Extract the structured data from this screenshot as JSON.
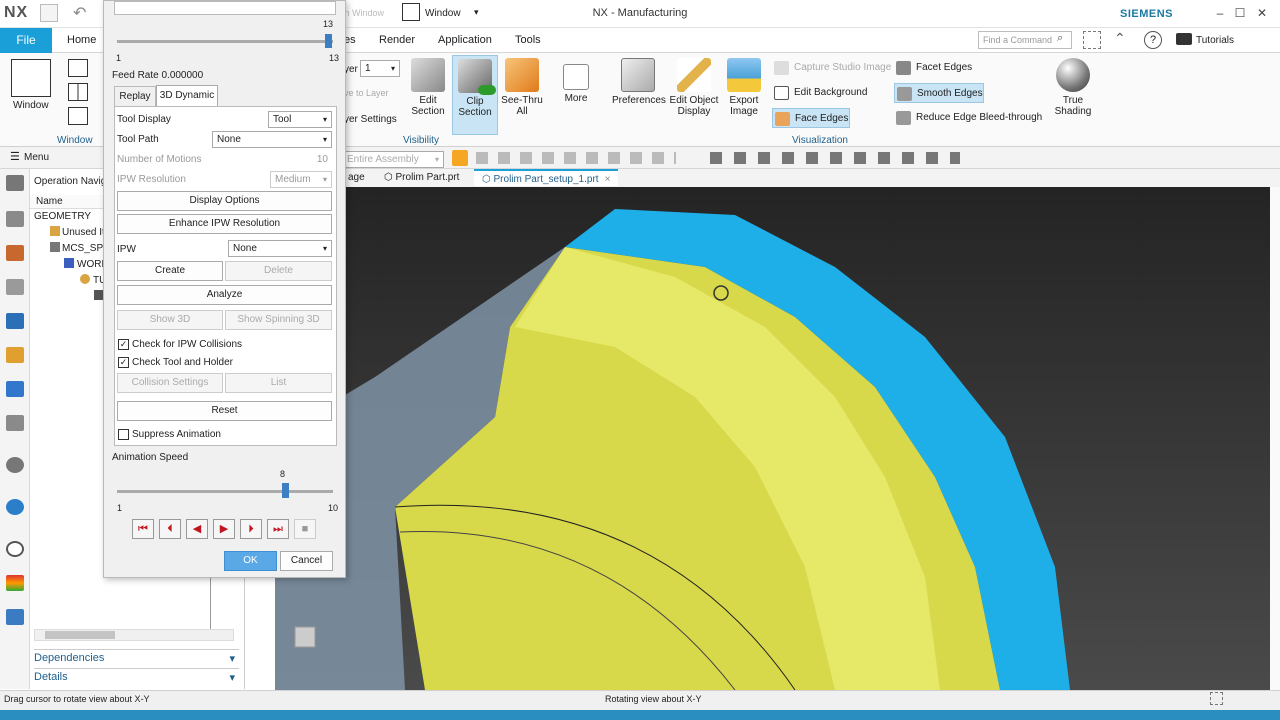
{
  "app": {
    "logo": "NX",
    "title": "NX - Manufacturing",
    "brand": "SIEMENS",
    "window_label": "Window",
    "switch_window": "ch Window"
  },
  "menu": {
    "file": "File",
    "tabs": [
      "Home",
      "es",
      "Render",
      "Application",
      "Tools"
    ],
    "find_placeholder": "Find a Command",
    "tutorials": "Tutorials"
  },
  "ribbon": {
    "window_group": "Window",
    "window_btn": "Window",
    "layer_label": "yer",
    "layer_value": "1",
    "move_to_layer": "ve to Layer",
    "layer_settings": "yer Settings",
    "edit_section": "Edit\nSection",
    "clip_section": "Clip\nSection",
    "see_thru": "See-Thru\nAll",
    "more": "More",
    "visibility_group": "Visibility",
    "preferences": "Preferences",
    "edit_object_display": "Edit Object\nDisplay",
    "export_image": "Export\nImage",
    "capture_studio": "Capture Studio Image",
    "edit_background": "Edit Background",
    "face_edges": "Face Edges",
    "facet_edges": "Facet Edges",
    "smooth_edges": "Smooth Edges",
    "reduce_edge": "Reduce Edge Bleed-through",
    "true_shading": "True\nShading",
    "visualization_group": "Visualization"
  },
  "selection": {
    "menu": "Menu",
    "filter": "Entire Assembly"
  },
  "doctabs": [
    "age",
    "Prolim Part.prt",
    "Prolim Part_setup_1.prt"
  ],
  "navigator": {
    "title": "Operation Navig",
    "column": "Name",
    "rows": [
      "GEOMETRY",
      "Unused It",
      "MCS_SPIN",
      "WORK",
      "TU"
    ],
    "dependencies": "Dependencies",
    "details": "Details"
  },
  "dialog": {
    "top_slider_max": "13",
    "top_slider_min": "1",
    "top_slider_right": "13",
    "feed_rate": "Feed Rate 0.000000",
    "tab_replay": "Replay",
    "tab_3d": "3D Dynamic",
    "tool_display_label": "Tool Display",
    "tool_display_value": "Tool",
    "tool_path_label": "Tool Path",
    "tool_path_value": "None",
    "num_motions_label": "Number of Motions",
    "num_motions_value": "10",
    "ipw_res_label": "IPW Resolution",
    "ipw_res_value": "Medium",
    "display_options": "Display Options",
    "enhance_ipw": "Enhance IPW Resolution",
    "ipw_label": "IPW",
    "ipw_value": "None",
    "create": "Create",
    "delete": "Delete",
    "analyze": "Analyze",
    "show3d": "Show 3D",
    "show_spinning": "Show Spinning 3D",
    "check_ipw": "Check for IPW Collisions",
    "check_tool": "Check Tool and Holder",
    "collision_settings": "Collision Settings",
    "list": "List",
    "reset": "Reset",
    "suppress": "Suppress Animation",
    "anim_speed": "Animation Speed",
    "speed_value": "8",
    "speed_min": "1",
    "speed_max": "10",
    "speed_fraction": 0.78,
    "ok": "OK",
    "cancel": "Cancel"
  },
  "status": {
    "left": "Drag cursor to rotate view about X-Y",
    "center": "Rotating view about X-Y"
  },
  "colors": {
    "accent": "#1a9fd8",
    "part_yellow": "#e8ea5e",
    "stock_blue": "#1eaee8",
    "viewport_bg": "#333333"
  }
}
